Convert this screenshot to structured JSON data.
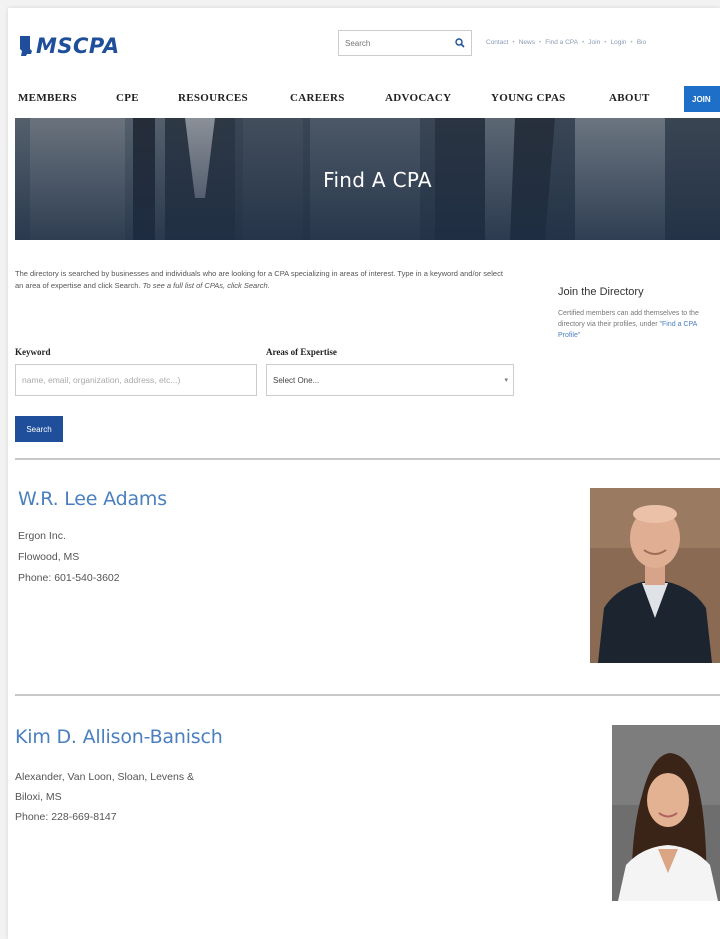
{
  "header": {
    "logo_text": "MSCPA",
    "search_placeholder": "Search",
    "utility_links": [
      "Contact",
      "News",
      "Find a CPA",
      "Join",
      "Login",
      "Bio"
    ]
  },
  "nav": {
    "items": [
      "MEMBERS",
      "CPE",
      "RESOURCES",
      "CAREERS",
      "ADVOCACY",
      "YOUNG CPAS",
      "ABOUT"
    ],
    "join_label": "JOIN"
  },
  "hero": {
    "title": "Find A CPA"
  },
  "intro": {
    "text_part1": "The directory is searched by businesses and individuals who are looking for a CPA specializing in areas of interest. Type in a keyword and/or select an area of expertise and click Search.",
    "text_part2": "To see a full list of CPAs, click Search."
  },
  "join_directory": {
    "heading": "Join the Directory",
    "text": "Certified members can add themselves to the directory via their profiles, under ",
    "link_text": "\"Find a CPA Profile\""
  },
  "form": {
    "keyword_label": "Keyword",
    "keyword_placeholder": "name, email, organization, address, etc...)",
    "expertise_label": "Areas of Expertise",
    "expertise_selected": "Select One...",
    "search_label": "Search"
  },
  "results": [
    {
      "name": "W.R. Lee Adams",
      "org": "Ergon Inc.",
      "city": "Flowood, MS",
      "phone": "Phone: 601-540-3602"
    },
    {
      "name": "Kim D. Allison-Banisch",
      "org": "Alexander, Van Loon, Sloan, Levens &",
      "city": "Biloxi, MS",
      "phone": "Phone: 228-669-8147"
    }
  ],
  "colors": {
    "brand": "#1f4e9a",
    "link": "#4a7fc0",
    "join_button": "#1e6fc7"
  }
}
